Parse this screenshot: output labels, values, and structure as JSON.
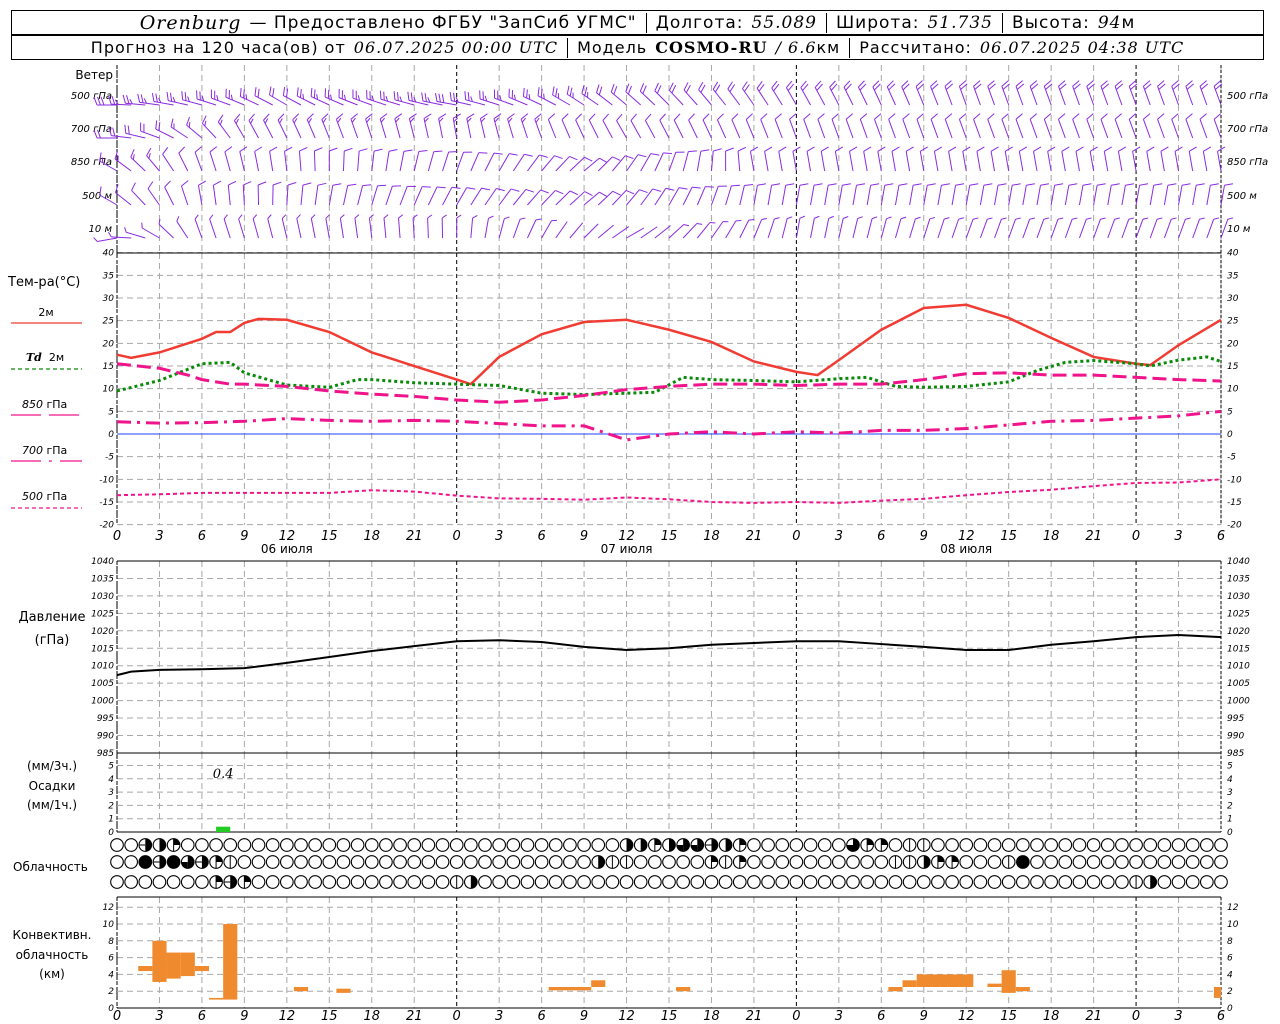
{
  "header": {
    "station": "Orenburg",
    "provider": "— Предоставлено ФГБУ \"ЗапСиб УГМС\"",
    "lon_label": "Долгота:",
    "lon": "55.089",
    "lat_label": "Широта:",
    "lat": "51.735",
    "alt_label": "Высота:",
    "alt": "94",
    "alt_unit": "м",
    "forecast_label": "Прогноз на 120 часа(ов) от",
    "forecast_start": "06.07.2025 00:00 UTC",
    "model_label": "Модель",
    "model": "COSMO-RU",
    "resolution": "/ 6.6",
    "resolution_unit": "км",
    "calc_label": "Рассчитано:",
    "calc_time": "06.07.2025 04:38 UTC"
  },
  "labels": {
    "wind": "Ветер",
    "temp": "Тем-ра(°C)",
    "t2m": "2м",
    "td": "Td",
    "td2m": "2м",
    "p850": "850",
    "p700": "700",
    "p500": "500",
    "hpa": "гПа",
    "pressure": "Давление",
    "pressure_unit": "(гПа)",
    "precip_3h": "(мм/3ч.)",
    "precip": "Осадки",
    "precip_1h": "(мм/1ч.)",
    "clouds": "Облачность",
    "conv1": "Конвективн.",
    "conv2": "облачность",
    "conv3": "(км)"
  },
  "colors": {
    "t2m": "#f03c32",
    "td": "#0a8a0a",
    "levels": "#f0148c",
    "zero": "#2040ff",
    "wind": "#8a2be2",
    "precip": "#22cc22",
    "conv": "#f08a2e"
  },
  "chart_data": [
    {
      "type": "line",
      "title": "Тем-ра(°C)",
      "x_unit": "hours from 06.07.2025 00 UTC",
      "xlim": [
        0,
        78
      ],
      "ylim": [
        -20,
        40
      ],
      "yticks": [
        40,
        35,
        30,
        25,
        20,
        15,
        10,
        5,
        0,
        -5,
        -10,
        -15,
        -20
      ],
      "grid": true,
      "series": [
        {
          "name": "2м",
          "x": [
            0,
            1,
            3,
            6,
            7,
            8,
            9,
            10,
            12,
            15,
            18,
            21,
            24,
            25,
            27,
            30,
            33,
            36,
            39,
            42,
            45,
            48,
            49.5,
            51,
            54,
            57,
            60,
            63,
            66,
            69,
            72,
            73,
            75,
            78
          ],
          "y": [
            17.5,
            16.8,
            18,
            21,
            22.5,
            22.5,
            24.5,
            25.4,
            25.2,
            22.5,
            18,
            15,
            12,
            11,
            17,
            22,
            24.7,
            25.2,
            23,
            20.3,
            16,
            13.7,
            13,
            16.3,
            23,
            27.8,
            28.5,
            25.6,
            21.2,
            17,
            15.5,
            15.2,
            19.6,
            25.2
          ]
        },
        {
          "name": "Td 2м",
          "x": [
            0,
            3,
            6,
            8,
            9,
            12,
            15,
            17,
            18,
            21,
            24,
            27,
            30,
            33,
            36,
            38,
            40,
            42,
            45,
            48,
            51,
            53,
            55,
            57,
            60,
            63,
            65,
            67,
            69,
            72,
            73,
            75,
            77,
            78
          ],
          "y": [
            9.5,
            11.8,
            15.5,
            15.8,
            13.5,
            10.8,
            10.3,
            12,
            12,
            11.3,
            11,
            10.7,
            9,
            8.7,
            9,
            9.2,
            12.5,
            12,
            11.8,
            11.5,
            12.2,
            12.5,
            10.5,
            10.3,
            10.5,
            11.5,
            14,
            15.8,
            16.2,
            15.5,
            15,
            16.3,
            17,
            16
          ]
        },
        {
          "name": "850 гПа",
          "x": [
            0,
            3,
            5,
            6,
            8,
            9,
            12,
            15,
            18,
            21,
            24,
            27,
            30,
            33,
            36,
            39,
            42,
            45,
            48,
            51,
            54,
            57,
            60,
            63,
            66,
            69,
            72,
            75,
            78
          ],
          "y": [
            15.5,
            14.5,
            13,
            12,
            11,
            11,
            10.5,
            9.5,
            8.8,
            8.3,
            7.5,
            7,
            7.5,
            8.5,
            9.8,
            10.5,
            11,
            11,
            10.7,
            11,
            11,
            12,
            13.3,
            13.5,
            13,
            13,
            12.5,
            12,
            11.7
          ]
        },
        {
          "name": "700 гПа",
          "x": [
            0,
            3,
            6,
            9,
            12,
            15,
            18,
            21,
            24,
            27,
            30,
            33,
            36,
            39,
            42,
            45,
            48,
            51,
            54,
            57,
            60,
            63,
            66,
            69,
            72,
            75,
            78
          ],
          "y": [
            2.7,
            2.4,
            2.5,
            2.8,
            3.4,
            3,
            2.8,
            3,
            2.8,
            2.3,
            1.8,
            1.8,
            -1.3,
            0,
            0.5,
            0,
            0.5,
            0.2,
            0.8,
            0.8,
            1.2,
            2,
            2.8,
            3,
            3.5,
            4,
            5
          ]
        },
        {
          "name": "500 гПа",
          "x": [
            0,
            3,
            6,
            9,
            12,
            15,
            18,
            21,
            24,
            27,
            30,
            33,
            36,
            39,
            42,
            45,
            48,
            51,
            54,
            57,
            60,
            63,
            66,
            69,
            72,
            75,
            78
          ],
          "y": [
            -13.5,
            -13.3,
            -13,
            -13,
            -13,
            -13,
            -12.4,
            -12.7,
            -13.6,
            -14.2,
            -14.3,
            -14.5,
            -14,
            -14.4,
            -15,
            -15.2,
            -15,
            -15.2,
            -14.7,
            -14.3,
            -13.5,
            -12.8,
            -12.3,
            -11.5,
            -10.8,
            -10.7,
            -10
          ]
        }
      ],
      "xticks": [
        "0",
        "3",
        "6",
        "9",
        "12",
        "15",
        "18",
        "21",
        "0",
        "3",
        "6",
        "9",
        "12",
        "15",
        "18",
        "21",
        "0",
        "3",
        "6",
        "9",
        "12",
        "15",
        "18",
        "21",
        "0",
        "3",
        "6"
      ],
      "dates": [
        {
          "x": 12,
          "label": "06 июля"
        },
        {
          "x": 36,
          "label": "07 июля"
        },
        {
          "x": 60,
          "label": "08 июля"
        }
      ]
    },
    {
      "type": "line",
      "title": "Давление",
      "ylabel": "(гПа)",
      "xlim": [
        0,
        78
      ],
      "ylim": [
        985,
        1040
      ],
      "yticks": [
        1040,
        1035,
        1030,
        1025,
        1020,
        1015,
        1010,
        1005,
        1000,
        995,
        990,
        985
      ],
      "grid": true,
      "series": [
        {
          "x": [
            0,
            1,
            3,
            6,
            9,
            12,
            15,
            18,
            21,
            24,
            27,
            30,
            33,
            36,
            39,
            42,
            45,
            48,
            51,
            54,
            57,
            60,
            63,
            66,
            69,
            72,
            75,
            78
          ],
          "y": [
            1007.3,
            1008.3,
            1008.8,
            1009,
            1009.3,
            1010.8,
            1012.5,
            1014.2,
            1015.6,
            1017,
            1017.3,
            1016.8,
            1015.4,
            1014.5,
            1015,
            1016,
            1016.5,
            1017,
            1017,
            1016.2,
            1015.4,
            1014.5,
            1014.5,
            1016,
            1017,
            1018.2,
            1018.8,
            1018.2
          ]
        }
      ]
    },
    {
      "type": "bar",
      "title": "Осадки",
      "ylabel": "(мм/1ч.)",
      "ylim": [
        0,
        5
      ],
      "yticks": [
        5,
        4,
        3,
        2,
        1,
        0
      ],
      "grid": true,
      "bars": [
        {
          "from": 7,
          "to": 8,
          "value": 0.4
        }
      ],
      "annotations": [
        {
          "x": 7.5,
          "text": "0.4"
        }
      ]
    },
    {
      "type": "table",
      "title": "Облачность",
      "legend": {
        "o": "0",
        "v": "<1/10",
        "q": "1/4",
        "h": "1/2",
        "H": "1/2 (line)",
        "t": "3/4",
        "f": "full"
      },
      "hours": 79,
      "rows": [
        {
          "2": "H",
          "3": "h",
          "4": "q",
          "36": "h",
          "37": "h",
          "38": "q",
          "39": "h",
          "40": "t",
          "41": "t",
          "42": "H",
          "43": "h",
          "44": "q",
          "52": "t",
          "53": "q",
          "54": "q",
          "56": "v",
          "57": "v"
        },
        {
          "2": "f",
          "3": "H",
          "4": "f",
          "5": "t",
          "6": "H",
          "7": "q",
          "8": "v",
          "34": "h",
          "35": "v",
          "36": "v",
          "42": "q",
          "43": "v",
          "44": "q",
          "55": "v",
          "56": "v",
          "57": "h",
          "58": "q",
          "59": "q",
          "63": "v",
          "64": "f"
        },
        {
          "7": "q",
          "8": "H",
          "9": "q",
          "24": "v",
          "25": "h",
          "72": "v",
          "73": "h"
        }
      ]
    },
    {
      "type": "bar",
      "title": "Конвективн. облачность",
      "ylabel": "(км)",
      "ylim": [
        0,
        13
      ],
      "yticks": [
        12,
        10,
        8,
        6,
        4,
        2,
        0
      ],
      "grid": true,
      "bars": [
        {
          "from": 1.5,
          "to": 2.5,
          "base": 4.4,
          "top": 5.0
        },
        {
          "from": 2.5,
          "to": 3.5,
          "base": 3.1,
          "top": 8.0
        },
        {
          "from": 3.5,
          "to": 4.5,
          "base": 3.5,
          "top": 6.6
        },
        {
          "from": 4.5,
          "to": 5.5,
          "base": 3.8,
          "top": 6.6
        },
        {
          "from": 5.5,
          "to": 6.5,
          "base": 4.4,
          "top": 5.0
        },
        {
          "from": 6.5,
          "to": 7.5,
          "base": 1.0,
          "top": 1.2
        },
        {
          "from": 7.5,
          "to": 8.5,
          "base": 1.0,
          "top": 10.0
        },
        {
          "from": 12.5,
          "to": 13.5,
          "base": 2.0,
          "top": 2.5
        },
        {
          "from": 15.5,
          "to": 16.5,
          "base": 1.8,
          "top": 2.3
        },
        {
          "from": 30.5,
          "to": 33.5,
          "base": 2.1,
          "top": 2.5
        },
        {
          "from": 33.5,
          "to": 34.5,
          "base": 2.5,
          "top": 3.3
        },
        {
          "from": 39.5,
          "to": 40.5,
          "base": 2.0,
          "top": 2.5
        },
        {
          "from": 54.5,
          "to": 55.5,
          "base": 2.0,
          "top": 2.5
        },
        {
          "from": 55.5,
          "to": 56.5,
          "base": 2.5,
          "top": 3.3
        },
        {
          "from": 56.5,
          "to": 60.5,
          "base": 2.5,
          "top": 4.0
        },
        {
          "from": 61.5,
          "to": 62.5,
          "base": 2.5,
          "top": 2.9
        },
        {
          "from": 62.5,
          "to": 63.5,
          "base": 1.8,
          "top": 4.5
        },
        {
          "from": 63.5,
          "to": 64.5,
          "base": 2.0,
          "top": 2.5
        },
        {
          "from": 77.5,
          "to": 78,
          "base": 1.2,
          "top": 2.5
        }
      ]
    },
    {
      "type": "scatter",
      "title": "Ветер",
      "note_units": "direction deg, speed m/s",
      "levels": [
        {
          "name": "500 гПа",
          "x": [
            0,
            12,
            24,
            36,
            48,
            60,
            78
          ],
          "dir": [
            270,
            300,
            280,
            310,
            330,
            340,
            340
          ],
          "speed": [
            15,
            12,
            15,
            12,
            10,
            12,
            12
          ]
        },
        {
          "name": "700 гПа",
          "x": [
            0,
            9,
            24,
            36,
            48,
            78
          ],
          "dir": [
            270,
            330,
            350,
            330,
            340,
            340
          ],
          "speed": [
            12,
            8,
            8,
            7,
            7,
            7
          ]
        },
        {
          "name": "850 гПа",
          "x": [
            0,
            6,
            24,
            33,
            45,
            78
          ],
          "dir": [
            300,
            340,
            20,
            50,
            350,
            350
          ],
          "speed": [
            8,
            7,
            6,
            5,
            6,
            6
          ]
        },
        {
          "name": "500 м",
          "x": [
            0,
            6,
            24,
            33,
            45,
            78
          ],
          "dir": [
            300,
            350,
            30,
            50,
            10,
            10
          ],
          "speed": [
            6,
            7,
            6,
            5,
            6,
            6
          ]
        },
        {
          "name": "10 м",
          "x": [
            0,
            6,
            24,
            36,
            48,
            60,
            78
          ],
          "dir": [
            260,
            340,
            0,
            60,
            10,
            20,
            20
          ],
          "speed": [
            3,
            4,
            3,
            2,
            4,
            3,
            3
          ]
        }
      ]
    }
  ]
}
